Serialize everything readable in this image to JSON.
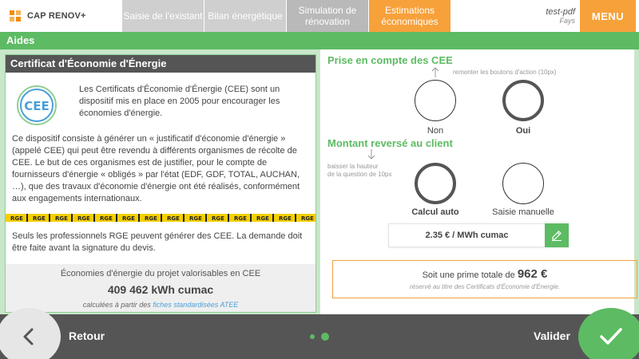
{
  "app": {
    "logo_text": "CAP RENOV+"
  },
  "header": {
    "tabs": [
      {
        "label": "Saisie de l'existant"
      },
      {
        "label": "Bilan énergétique"
      },
      {
        "label": "Simulation de rénovation"
      },
      {
        "label": "Estimations économiques"
      }
    ],
    "user_name": "test-pdf",
    "user_place": "Fays",
    "menu_label": "MENU"
  },
  "section": {
    "title": "Aides"
  },
  "left": {
    "panel_title": "Certificat d'Économie d'Énergie",
    "badge_text": "CEE",
    "intro": "Les Certificats d'Économie d'Énergie (CEE) sont un dispositif mis en place en 2005 pour encourager les économies d'énergie.",
    "paragraph": "Ce dispositif consiste à générer un « justificatif d'économie d'énergie » (appelé CEE) qui peut être revendu à différents organismes de récolte de CEE. Le but de ces organismes est de justifier, pour le compte de fournisseurs d'énergie « obligés » par l'état (EDF, GDF, TOTAL, AUCHAN, …), que des travaux d'économie d'énergie ont été réalisés, conformément aux engagements internationaux.",
    "rge_label": "RGE",
    "paragraph2": "Seuls les professionnels RGE peuvent générer des CEE. La demande doit être faite avant la signature du devis.",
    "savings_label": "Économies d'énergie du projet valorisables en CEE",
    "savings_value": "409 462 kWh cumac",
    "savings_note_prefix": "calculées à partir des",
    "savings_note_link": "fiches standardisées ATEE"
  },
  "right": {
    "q1_title": "Prise en compte des CEE",
    "q1_hint": "remonter les boutons d'action (10px)",
    "q1_options": [
      {
        "label": "Non",
        "selected": false
      },
      {
        "label": "Oui",
        "selected": true
      }
    ],
    "q2_title": "Montant reversé au client",
    "q2_hint_line1": "baisser la hauteur",
    "q2_hint_line2": "de la question de 10px",
    "q2_options": [
      {
        "label": "Calcul auto",
        "selected": true
      },
      {
        "label": "Saisie manuelle",
        "selected": false
      }
    ],
    "amount_value": "2.35 € / MWh cumac",
    "prime_prefix": "Soit une prime totale de",
    "prime_amount": "962 €",
    "prime_note": "réservé au titre des Certificats d'Économie d'Énergie."
  },
  "footer": {
    "back_label": "Retour",
    "validate_label": "Valider"
  },
  "colors": {
    "green": "#5dbb63",
    "orange": "#f7a13b",
    "dark_gray": "#555555"
  },
  "icons": {
    "back": "chevron-left-icon",
    "validate": "checkmark-icon",
    "edit": "pencil-icon",
    "hint": "up-arrow-icon"
  }
}
